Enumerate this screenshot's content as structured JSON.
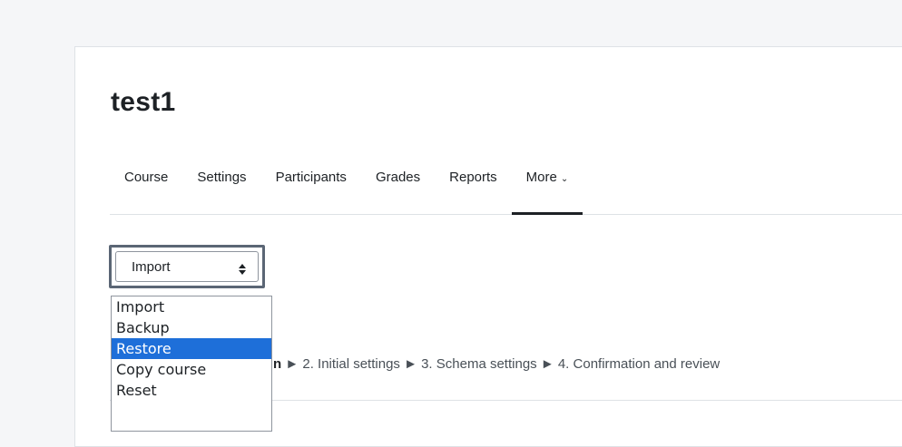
{
  "course": {
    "title": "test1"
  },
  "nav": {
    "items": [
      {
        "label": "Course"
      },
      {
        "label": "Settings"
      },
      {
        "label": "Participants"
      },
      {
        "label": "Grades"
      },
      {
        "label": "Reports"
      },
      {
        "label": "More"
      }
    ],
    "active_index": 5
  },
  "action_select": {
    "value": "Import",
    "options": [
      "Import",
      "Backup",
      "Restore",
      "Copy course",
      "Reset"
    ],
    "highlighted": "Restore"
  },
  "steps": {
    "current_fragment": "n",
    "rest": " ► 2. Initial settings ► 3. Schema settings ► 4. Confirmation and review"
  },
  "colors": {
    "highlight": "#1e6fd9",
    "focus_ring": "#5b6675"
  }
}
